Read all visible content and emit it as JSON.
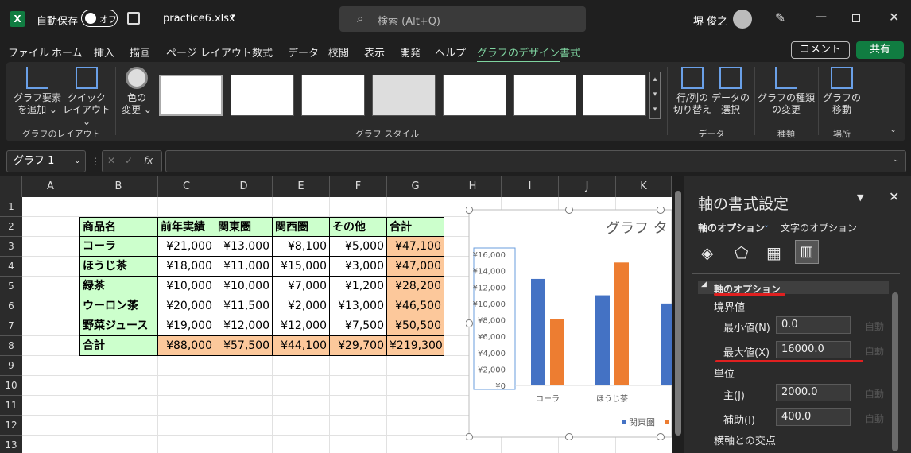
{
  "titlebar": {
    "autosave_label": "自動保存",
    "toggle_label": "オフ",
    "filename": "practice6.xlsx",
    "search_placeholder": "検索 (Alt+Q)",
    "user_name": "堺 俊之"
  },
  "menu": {
    "tabs": [
      "ファイル",
      "ホーム",
      "挿入",
      "描画",
      "ページ レイアウト",
      "数式",
      "データ",
      "校閲",
      "表示",
      "開発",
      "ヘルプ",
      "グラフのデザイン",
      "書式"
    ],
    "comment_label": "コメント",
    "share_label": "共有"
  },
  "ribbon": {
    "add_element": [
      "グラフ要素",
      "を追加 ⌄"
    ],
    "quick_layout": [
      "クイック",
      "レイアウト ⌄"
    ],
    "change_color": [
      "色の",
      "変更 ⌄"
    ],
    "switch_rowcol": [
      "行/列の",
      "切り替え"
    ],
    "select_data": [
      "データの",
      "選択"
    ],
    "change_type": [
      "グラフの種類",
      "の変更"
    ],
    "move_chart": [
      "グラフの",
      "移動"
    ],
    "group_layout": "グラフのレイアウト",
    "group_styles": "グラフ スタイル",
    "group_data": "データ",
    "group_type": "種類",
    "group_location": "場所"
  },
  "formula": {
    "namebox": "グラフ 1",
    "fx": "fx"
  },
  "sheet": {
    "columns": [
      "A",
      "B",
      "C",
      "D",
      "E",
      "F",
      "G",
      "H",
      "I",
      "J",
      "K"
    ],
    "rows": [
      "1",
      "2",
      "3",
      "4",
      "5",
      "6",
      "7",
      "8",
      "9",
      "10",
      "11",
      "12",
      "13"
    ],
    "header": [
      "商品名",
      "前年実績",
      "関東圏",
      "関西圏",
      "その他",
      "合計"
    ],
    "data": [
      [
        "コーラ",
        "¥21,000",
        "¥13,000",
        "¥8,100",
        "¥5,000",
        "¥47,100"
      ],
      [
        "ほうじ茶",
        "¥18,000",
        "¥11,000",
        "¥15,000",
        "¥3,000",
        "¥47,000"
      ],
      [
        "緑茶",
        "¥10,000",
        "¥10,000",
        "¥7,000",
        "¥1,200",
        "¥28,200"
      ],
      [
        "ウーロン茶",
        "¥20,000",
        "¥11,500",
        "¥2,000",
        "¥13,000",
        "¥46,500"
      ],
      [
        "野菜ジュース",
        "¥19,000",
        "¥12,000",
        "¥12,000",
        "¥7,500",
        "¥50,500"
      ],
      [
        "合計",
        "¥88,000",
        "¥57,500",
        "¥44,100",
        "¥29,700",
        "¥219,300"
      ]
    ],
    "colors": {
      "header_bg": "#ccffcc",
      "total_bg": "#fcc89b"
    }
  },
  "chart_data": {
    "type": "bar",
    "title": "グラフ タ",
    "categories": [
      "コーラ",
      "ほうじ茶"
    ],
    "yticks": [
      "¥16,000",
      "¥14,000",
      "¥12,000",
      "¥10,000",
      "¥8,000",
      "¥6,000",
      "¥4,000",
      "¥2,000",
      "¥0"
    ],
    "ylim": [
      0,
      16000
    ],
    "series": [
      {
        "name": "関東圏",
        "color": "#4472c4",
        "values": [
          13000,
          11000
        ]
      },
      {
        "color": "#ed7d31",
        "values": [
          8100,
          15000
        ]
      }
    ],
    "partial_bar": {
      "color": "#4472c4",
      "value": 10000
    },
    "legend": "bottom"
  },
  "pane": {
    "title": "軸の書式設定",
    "tab_axis": "軸のオプション",
    "tab_text": "文字のオプション",
    "section": "軸のオプション",
    "bounds": "境界値",
    "min_label": "最小値(N)",
    "min_value": "0.0",
    "max_label": "最大値(X)",
    "max_value": "16000.0",
    "units": "単位",
    "major_label": "主(J)",
    "major_value": "2000.0",
    "minor_label": "補助(I)",
    "minor_value": "400.0",
    "cross": "横軸との交点",
    "auto": "自動"
  }
}
